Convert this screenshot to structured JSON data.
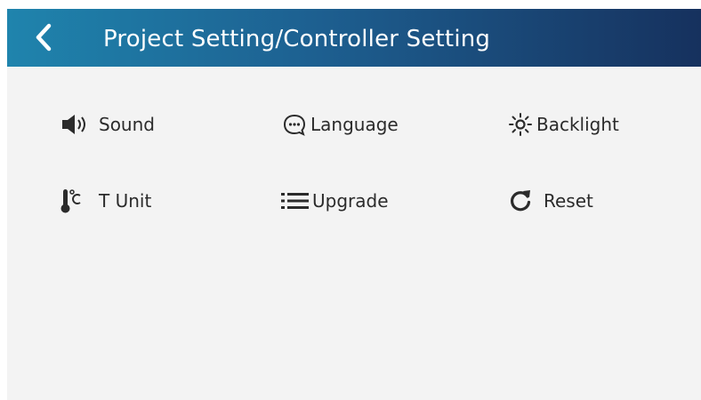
{
  "header": {
    "title": "Project Setting/Controller Setting",
    "back_icon": "chevron-left-icon"
  },
  "menu": {
    "items": [
      {
        "label": "Sound",
        "icon": "speaker-icon"
      },
      {
        "label": "Language",
        "icon": "chat-bubble-icon"
      },
      {
        "label": "Backlight",
        "icon": "sun-icon"
      },
      {
        "label": "T Unit",
        "icon": "thermometer-celsius-icon"
      },
      {
        "label": "Upgrade",
        "icon": "list-icon"
      },
      {
        "label": "Reset",
        "icon": "refresh-icon"
      }
    ]
  },
  "colors": {
    "header_gradient_start": "#1f84ad",
    "header_gradient_end": "#16315e",
    "background": "#f3f3f3",
    "text": "#2b2b2b"
  }
}
